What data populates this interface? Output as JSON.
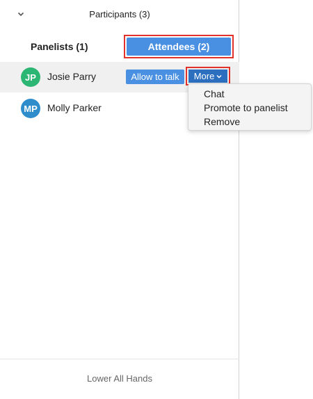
{
  "header": {
    "title": "Participants (3)",
    "collapse_icon": "chevron-down-icon"
  },
  "tabs": {
    "panelists_label": "Panelists (1)",
    "attendees_label": "Attendees (2)",
    "active": "attendees"
  },
  "attendees": [
    {
      "initials": "JP",
      "name": "Josie Parry",
      "avatar_color": "#2bb673",
      "allow_label": "Allow to talk",
      "more_label": "More"
    },
    {
      "initials": "MP",
      "name": "Molly Parker",
      "avatar_color": "#2f8dcc"
    }
  ],
  "more_menu": {
    "items": [
      "Chat",
      "Promote to panelist",
      "Remove"
    ]
  },
  "footer": {
    "lower_all_hands_label": "Lower All Hands"
  },
  "colors": {
    "accent": "#4a90e2",
    "accent_dark": "#2d6fbf",
    "highlight_border": "#e0312a"
  }
}
